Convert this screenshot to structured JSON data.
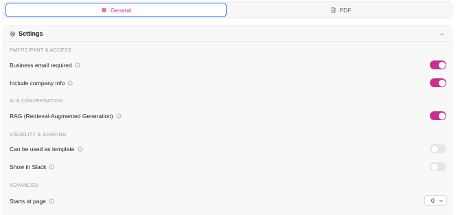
{
  "tabs": [
    {
      "label": "General",
      "icon": "gear-icon",
      "active": true
    },
    {
      "label": "PDF",
      "icon": "document-icon",
      "active": false
    }
  ],
  "panel": {
    "title": "Settings",
    "icon": "gear-icon"
  },
  "sections": [
    {
      "label": "PARTICIPANT & ACCESS"
    },
    {
      "label": "AI & CONVERSATION"
    },
    {
      "label": "VISIBILITY & SHARING"
    },
    {
      "label": "ADVANCED"
    }
  ],
  "settings": {
    "business_email": {
      "label": "Business email required",
      "enabled": true
    },
    "company_info": {
      "label": "Include company info",
      "enabled": true
    },
    "rag": {
      "label": "RAG (Retrieval-Augmented Generation)",
      "enabled": true
    },
    "template": {
      "label": "Can be used as template",
      "enabled": false
    },
    "slack": {
      "label": "Show in Slack",
      "enabled": false
    },
    "start_page": {
      "label": "Starts at page",
      "value": "0"
    }
  },
  "colors": {
    "accent": "#c8318f",
    "focus_border": "#2f6fd8",
    "toggle_off": "#e6e6ea"
  }
}
